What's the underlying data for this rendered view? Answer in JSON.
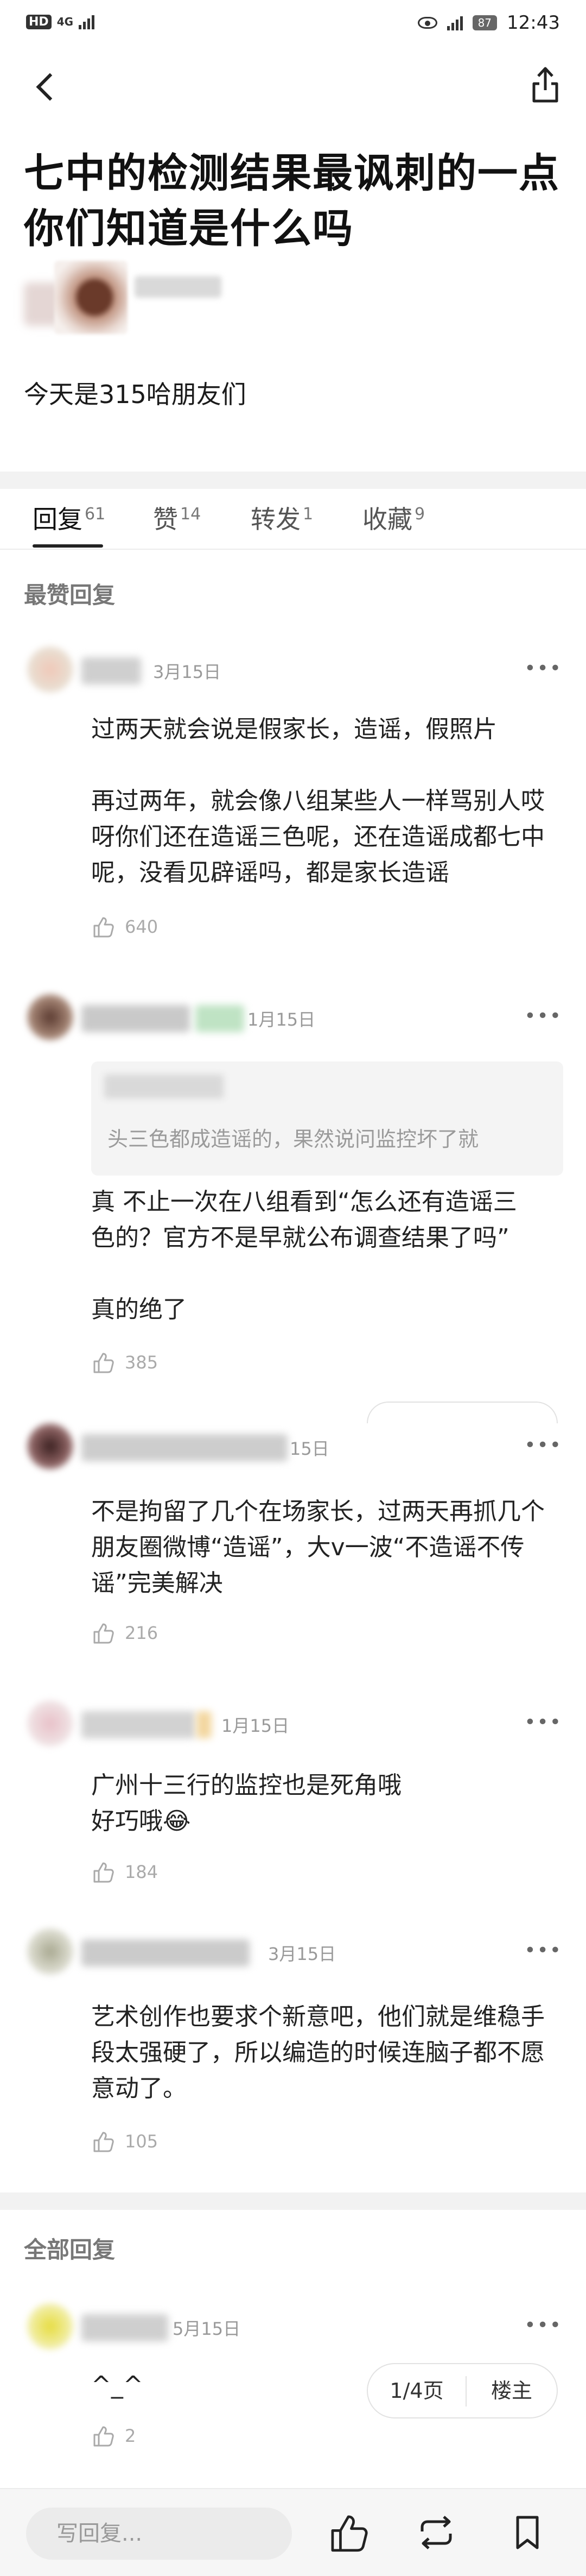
{
  "status_bar": {
    "hd": "HD",
    "network": "4G",
    "battery": "87",
    "time": "12:43"
  },
  "post": {
    "title_line1": "七中的检测结果最讽刺的一点",
    "title_line2": "你们知道是什么吗",
    "body": "今天是315哈朋友们"
  },
  "tabs": [
    {
      "label": "回复",
      "count": "61"
    },
    {
      "label": "赞",
      "count": "14"
    },
    {
      "label": "转发",
      "count": "1"
    },
    {
      "label": "收藏",
      "count": "9"
    }
  ],
  "sections": {
    "top": "最赞回复",
    "all": "全部回复"
  },
  "comments": [
    {
      "date": "3月15日",
      "p1": "过两天就会说是假家长，造谣，假照片",
      "p2_l1": "再过两年，就会像八组某些人一样骂别人哎",
      "p2_l2": "呀你们还在造谣三色呢，还在造谣成都七中",
      "p2_l3": "呢，没看见辟谣吗，都是家长造谣",
      "likes": "640"
    },
    {
      "date": "1月15日",
      "quote": "头三色都成造谣的，果然说问监控坏了就",
      "l1": "真 不止一次在八组看到“怎么还有造谣三",
      "l2": "色的？官方不是早就公布调查结果了吗”",
      "l3": "真的绝了",
      "likes": "385"
    },
    {
      "date": "15日",
      "l1": "不是拘留了几个在场家长，过两天再抓几个",
      "l2": "朋友圈微博“造谣”，大v一波“不造谣不传",
      "l3": "谣”完美解决",
      "likes": "216"
    },
    {
      "date": "1月15日",
      "l1": "广州十三行的监控也是死角哦",
      "l2": "好巧哦😂",
      "likes": "184"
    },
    {
      "date": "3月15日",
      "l1": "艺术创作也要求个新意吧，他们就是维稳手",
      "l2": "段太强硬了，所以编造的时候连脑子都不愿",
      "l3": "意动了。",
      "likes": "105"
    },
    {
      "date": "5月15日",
      "l1": "^_^",
      "likes": "2"
    }
  ],
  "pager": {
    "pages": "1/4页",
    "owner": "楼主"
  },
  "bottom": {
    "reply_placeholder": "写回复..."
  },
  "colors": {
    "accent": "#222222",
    "muted": "#999999",
    "band": "#f2f2f2"
  }
}
